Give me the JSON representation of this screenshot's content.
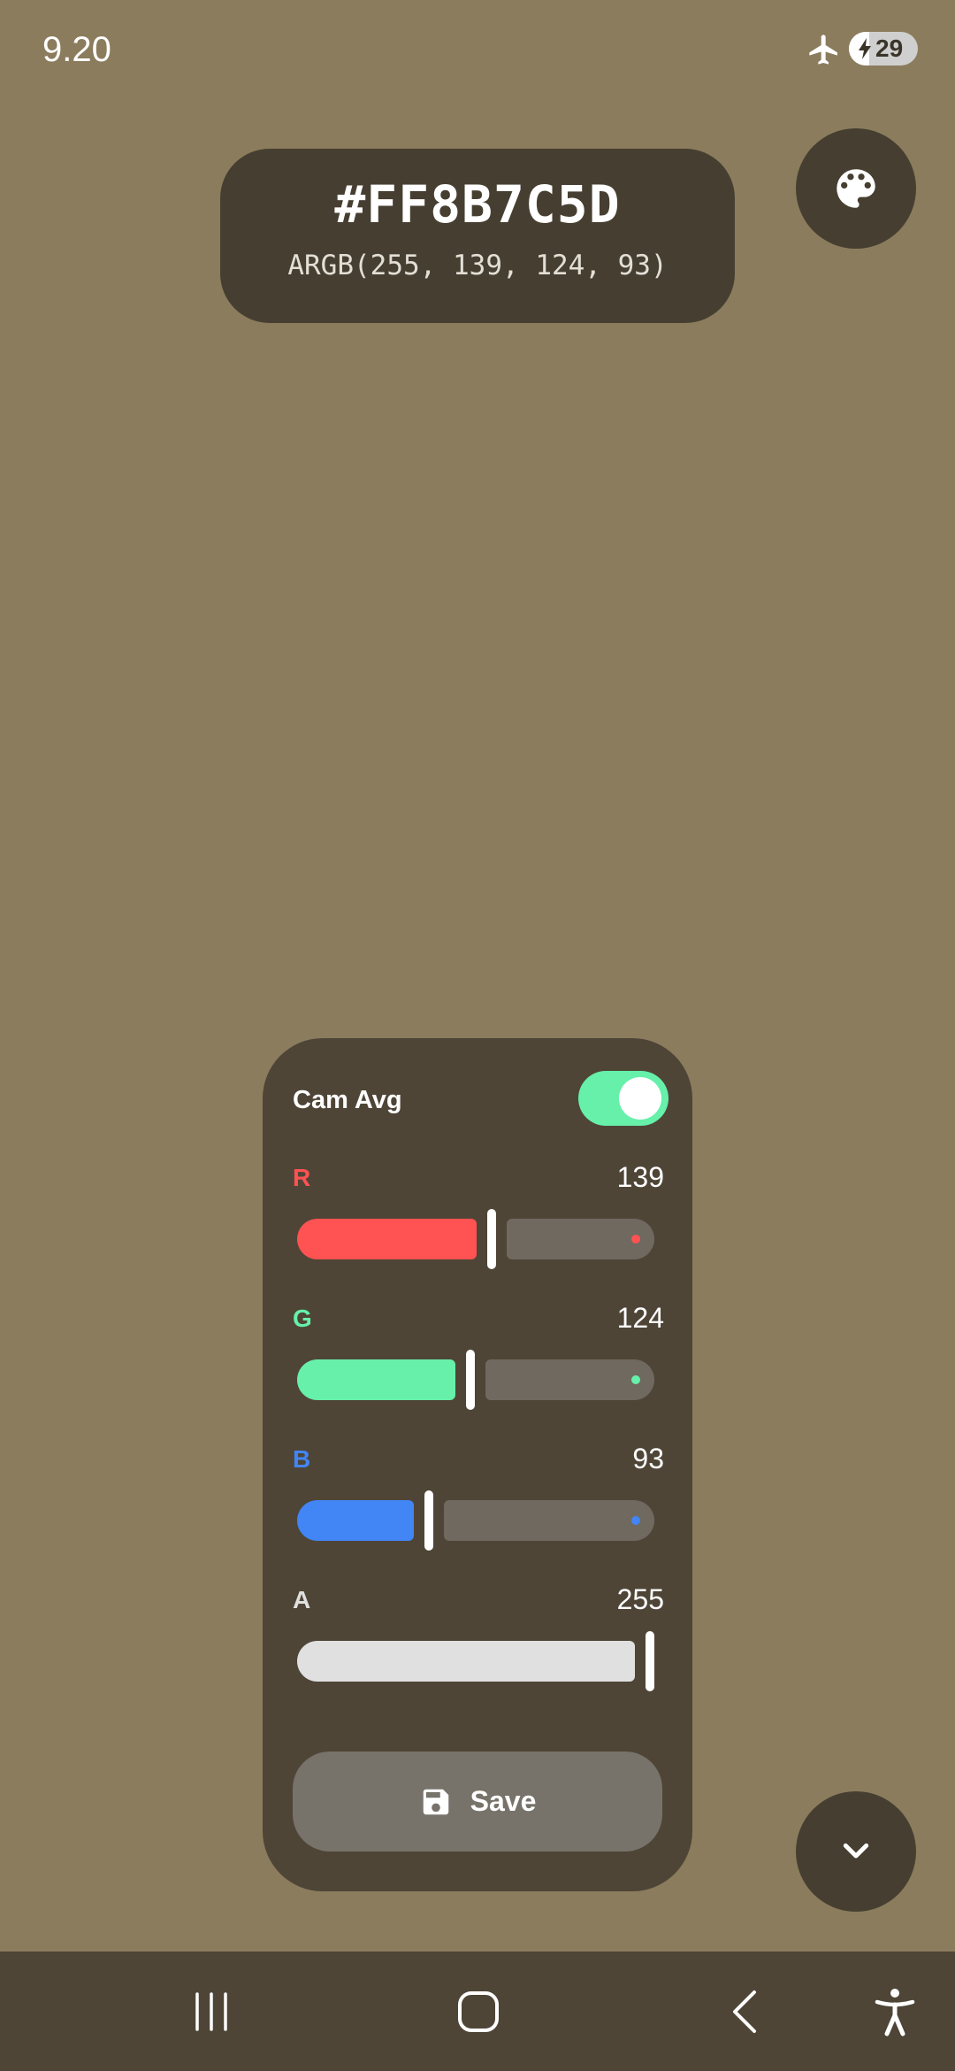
{
  "status_bar": {
    "time": "9.20",
    "battery_level": "29",
    "battery_fraction": 0.29,
    "icons": [
      "airplane-mode-icon",
      "battery-charging-icon"
    ]
  },
  "color_card": {
    "hex": "#FF8B7C5D",
    "argb": "ARGB(255, 139, 124, 93)"
  },
  "panel": {
    "cam_avg_label": "Cam Avg",
    "cam_avg_enabled": true,
    "channels": [
      {
        "label": "R",
        "value": "139",
        "fraction": 0.545,
        "color": "#FF5252"
      },
      {
        "label": "G",
        "value": "124",
        "fraction": 0.486,
        "color": "#66F0AA"
      },
      {
        "label": "B",
        "value": "93",
        "fraction": 0.365,
        "color": "#4285F4"
      },
      {
        "label": "A",
        "value": "255",
        "fraction": 1.0,
        "color": "#E0E0E0"
      }
    ],
    "save_label": "Save"
  },
  "navigation": {
    "items": [
      "recent-apps",
      "home",
      "back",
      "accessibility"
    ]
  },
  "colors": {
    "background": "#8B7C5D",
    "panel": "#4E4537",
    "card": "#463F31",
    "accent_toggle": "#66F0AA"
  }
}
